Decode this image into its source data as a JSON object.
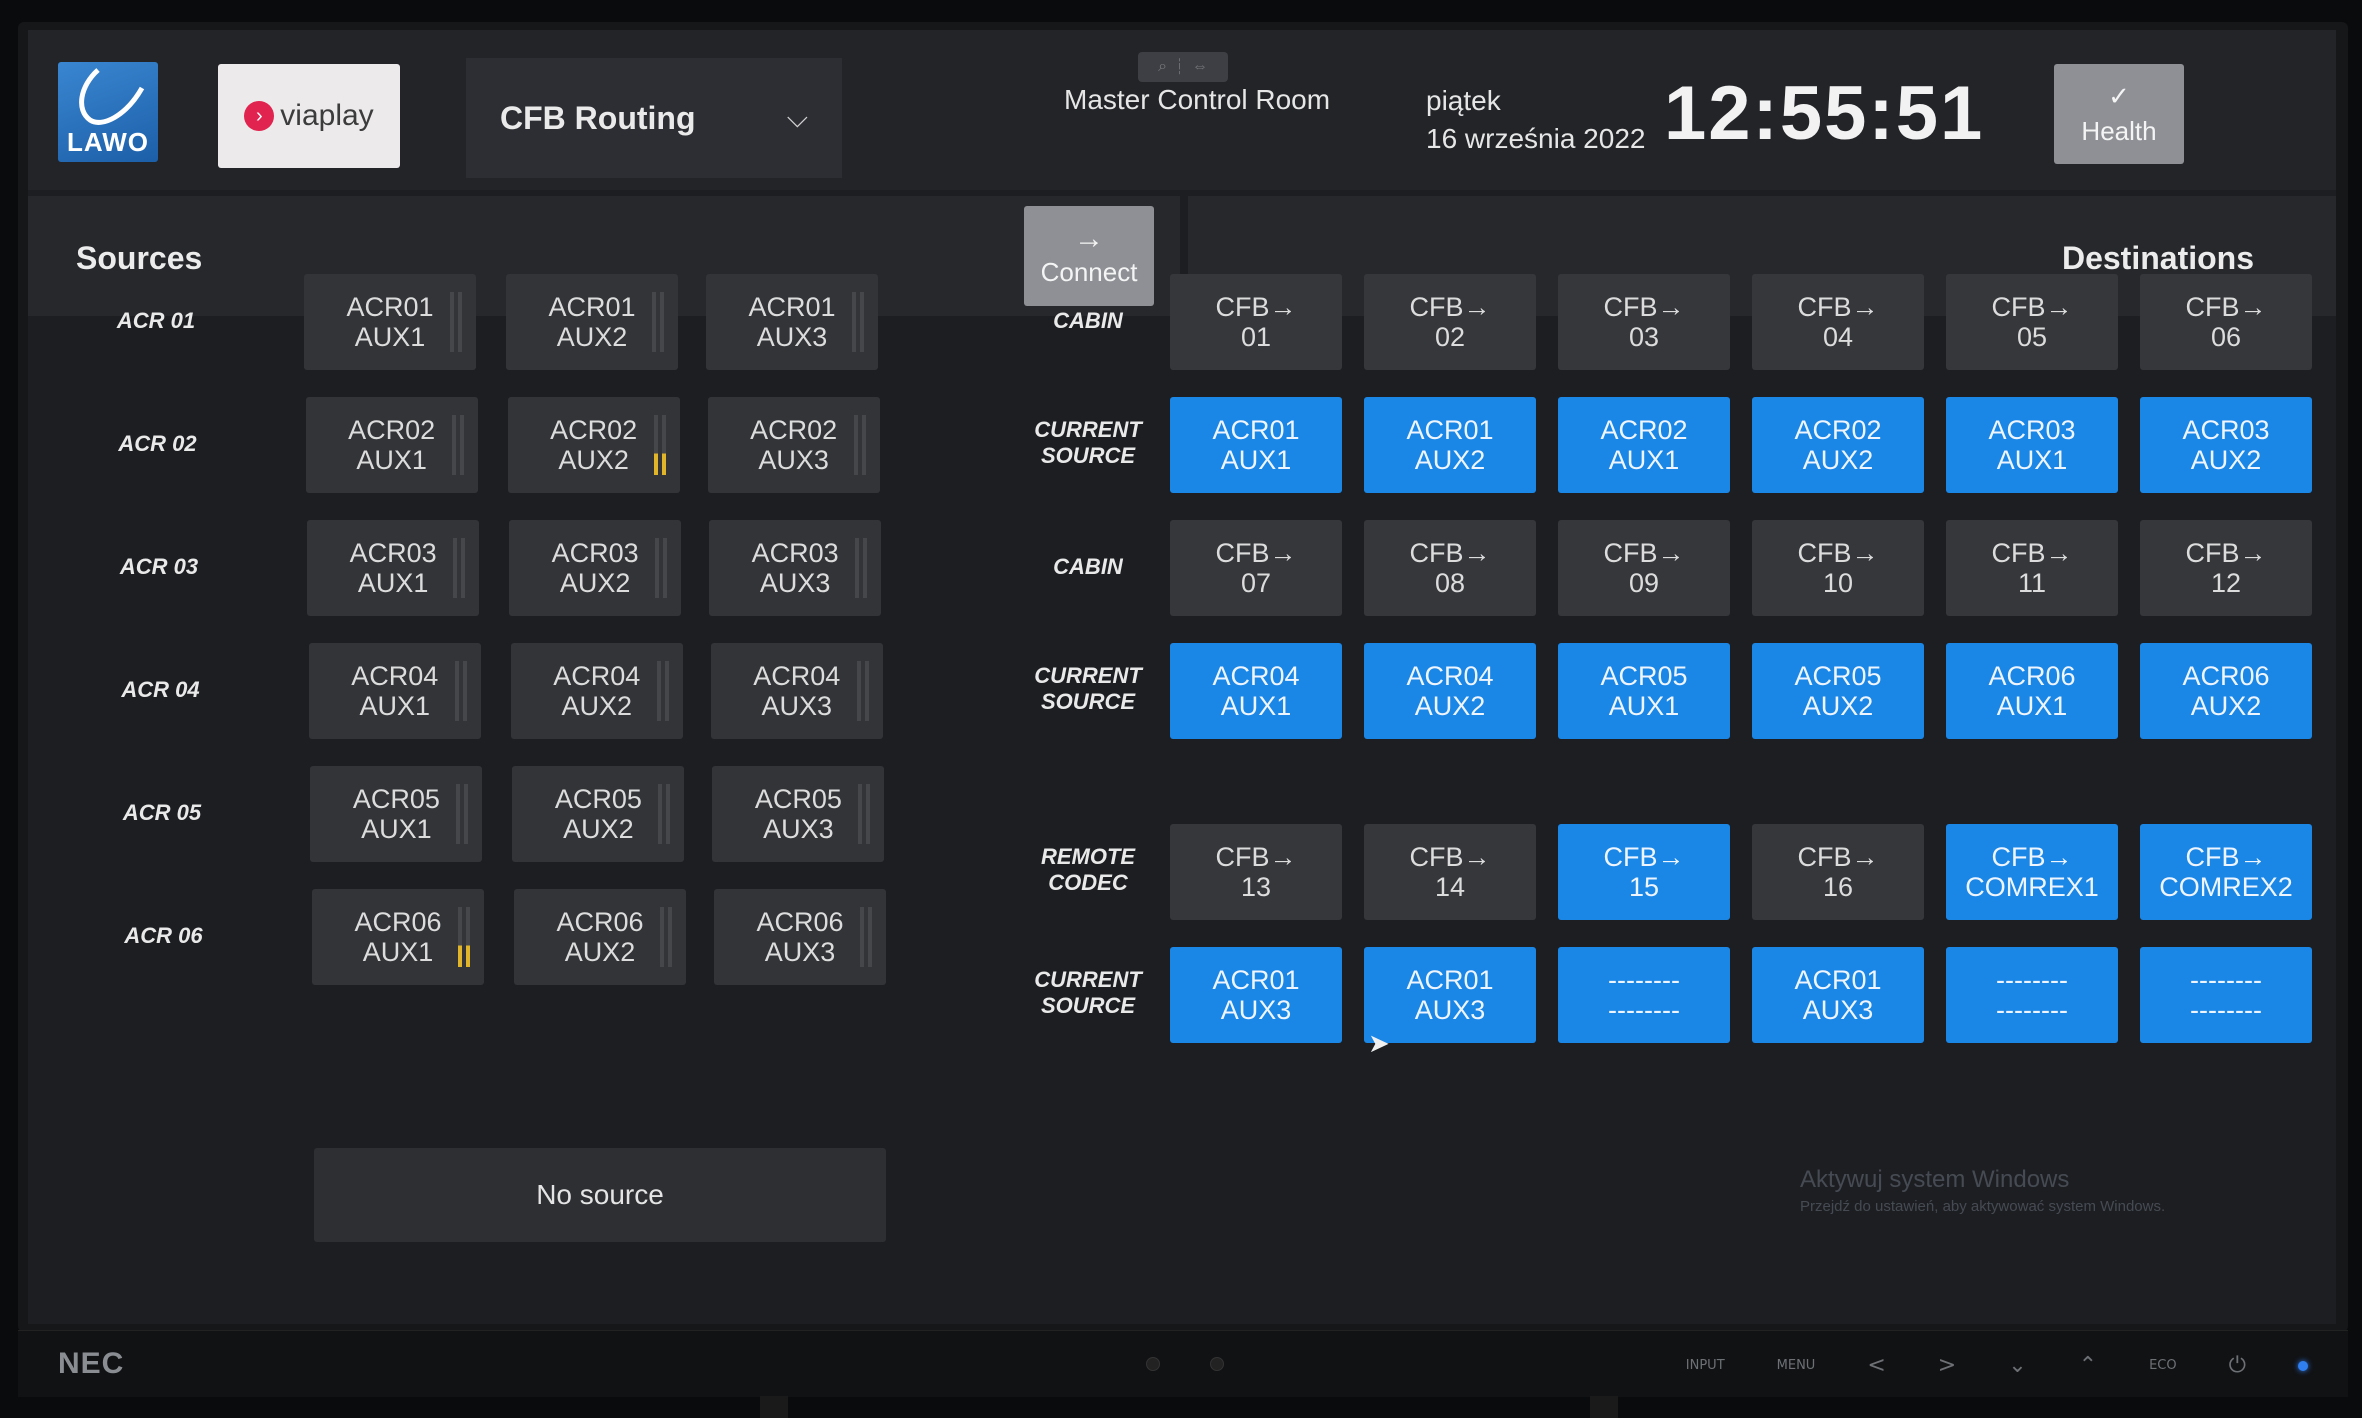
{
  "header": {
    "logo_text": "LAWO",
    "brand": "viaplay",
    "routing_select": "CFB Routing",
    "room": "Master Control Room",
    "day": "piątek",
    "date": "16 września 2022",
    "clock": "12:55:51",
    "health_label": "Health",
    "health_icon": "check-icon"
  },
  "sources": {
    "title": "Sources",
    "rows": [
      {
        "label": "ACR 01",
        "items": [
          [
            "ACR01",
            "AUX1"
          ],
          [
            "ACR01",
            "AUX2"
          ],
          [
            "ACR01",
            "AUX3"
          ]
        ]
      },
      {
        "label": "ACR 02",
        "items": [
          [
            "ACR02",
            "AUX1"
          ],
          [
            "ACR02",
            "AUX2"
          ],
          [
            "ACR02",
            "AUX3"
          ]
        ]
      },
      {
        "label": "ACR 03",
        "items": [
          [
            "ACR03",
            "AUX1"
          ],
          [
            "ACR03",
            "AUX2"
          ],
          [
            "ACR03",
            "AUX3"
          ]
        ]
      },
      {
        "label": "ACR 04",
        "items": [
          [
            "ACR04",
            "AUX1"
          ],
          [
            "ACR04",
            "AUX2"
          ],
          [
            "ACR04",
            "AUX3"
          ]
        ]
      },
      {
        "label": "ACR 05",
        "items": [
          [
            "ACR05",
            "AUX1"
          ],
          [
            "ACR05",
            "AUX2"
          ],
          [
            "ACR05",
            "AUX3"
          ]
        ]
      },
      {
        "label": "ACR 06",
        "items": [
          [
            "ACR06",
            "AUX1"
          ],
          [
            "ACR06",
            "AUX2"
          ],
          [
            "ACR06",
            "AUX3"
          ]
        ]
      }
    ],
    "no_source": "No source"
  },
  "connect": {
    "label": "Connect",
    "icon": "arrow-right-icon"
  },
  "destinations": {
    "title": "Destinations",
    "rows": [
      {
        "label": [
          "CABIN"
        ],
        "kind": "dst",
        "items": [
          [
            "CFB→",
            "01"
          ],
          [
            "CFB→",
            "02"
          ],
          [
            "CFB→",
            "03"
          ],
          [
            "CFB→",
            "04"
          ],
          [
            "CFB→",
            "05"
          ],
          [
            "CFB→",
            "06"
          ]
        ]
      },
      {
        "label": [
          "CURRENT",
          "SOURCE"
        ],
        "kind": "cur",
        "items": [
          [
            "ACR01",
            "AUX1"
          ],
          [
            "ACR01",
            "AUX2"
          ],
          [
            "ACR02",
            "AUX1"
          ],
          [
            "ACR02",
            "AUX2"
          ],
          [
            "ACR03",
            "AUX1"
          ],
          [
            "ACR03",
            "AUX2"
          ]
        ]
      },
      {
        "label": [
          "CABIN"
        ],
        "kind": "dst",
        "items": [
          [
            "CFB→",
            "07"
          ],
          [
            "CFB→",
            "08"
          ],
          [
            "CFB→",
            "09"
          ],
          [
            "CFB→",
            "10"
          ],
          [
            "CFB→",
            "11"
          ],
          [
            "CFB→",
            "12"
          ]
        ]
      },
      {
        "label": [
          "CURRENT",
          "SOURCE"
        ],
        "kind": "cur",
        "items": [
          [
            "ACR04",
            "AUX1"
          ],
          [
            "ACR04",
            "AUX2"
          ],
          [
            "ACR05",
            "AUX1"
          ],
          [
            "ACR05",
            "AUX2"
          ],
          [
            "ACR06",
            "AUX1"
          ],
          [
            "ACR06",
            "AUX2"
          ]
        ]
      },
      {
        "label": [
          "REMOTE",
          "CODEC"
        ],
        "kind": "dst",
        "items": [
          [
            "CFB→",
            "13"
          ],
          [
            "CFB→",
            "14"
          ],
          [
            "CFB→",
            "15"
          ],
          [
            "CFB→",
            "16"
          ],
          [
            "CFB→",
            "COMREX1"
          ],
          [
            "CFB→",
            "COMREX2"
          ]
        ],
        "selected": [
          2,
          4,
          5
        ]
      },
      {
        "label": [
          "CURRENT",
          "SOURCE"
        ],
        "kind": "cur",
        "items": [
          [
            "ACR01",
            "AUX3"
          ],
          [
            "ACR01",
            "AUX3"
          ],
          [
            "--------",
            "--------"
          ],
          [
            "ACR01",
            "AUX3"
          ],
          [
            "--------",
            "--------"
          ],
          [
            "--------",
            "--------"
          ]
        ]
      }
    ]
  },
  "watermark": {
    "title": "Aktywuj system Windows",
    "subtitle": "Przejdź do ustawień, aby aktywować system Windows."
  },
  "monitor": {
    "brand": "NEC",
    "buttons": [
      "INPUT",
      "MENU",
      "<",
      ">",
      "⌄",
      "⌃",
      "ECO",
      "⏻"
    ]
  },
  "colors": {
    "accent_blue": "#1a86e6",
    "meter_yellow": "#e0b52a"
  }
}
